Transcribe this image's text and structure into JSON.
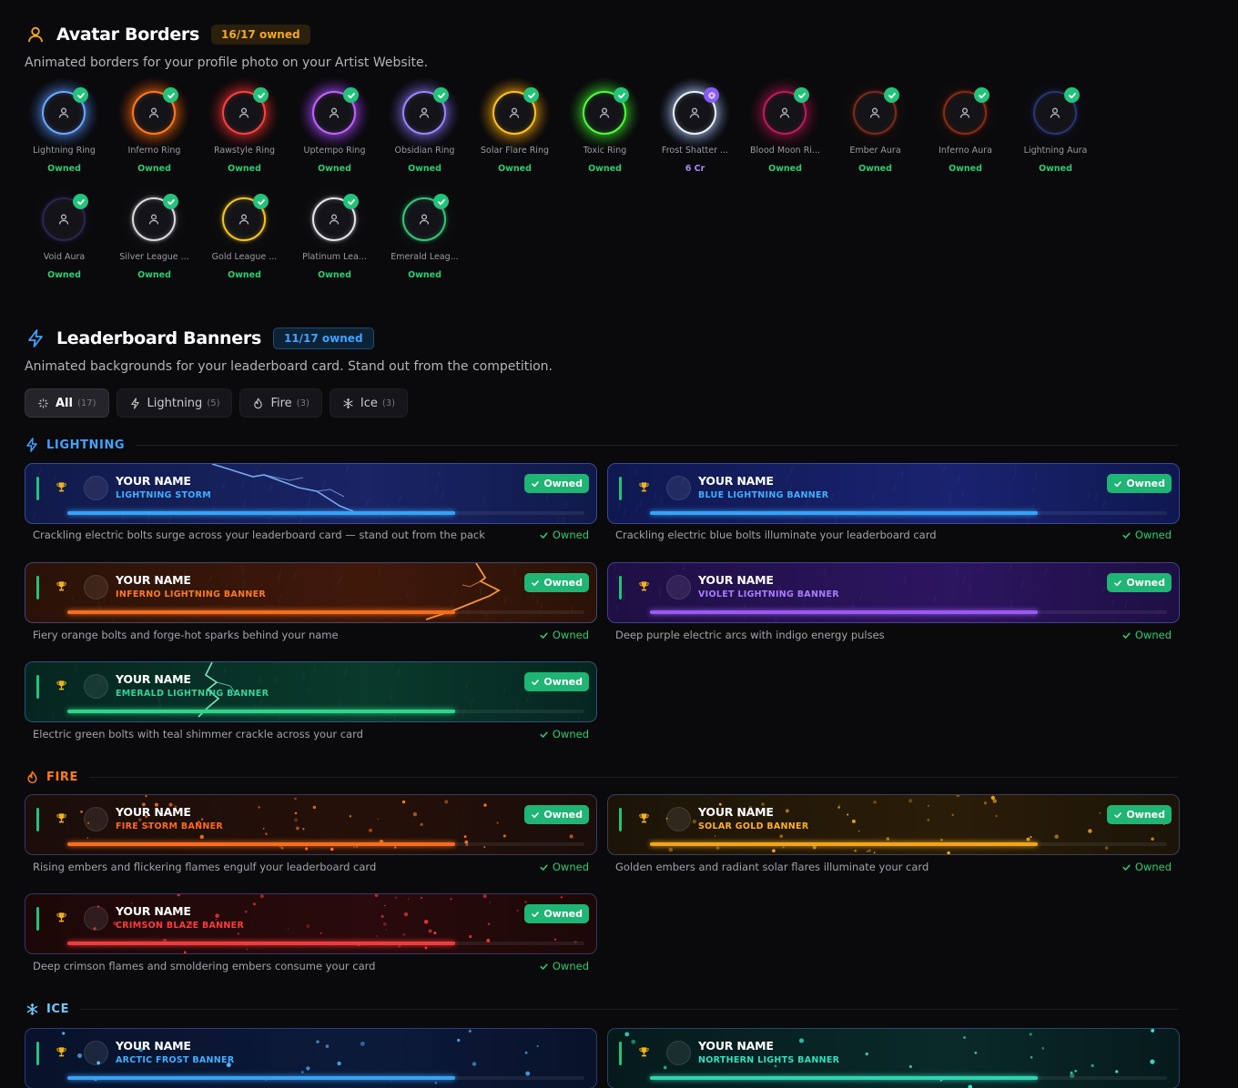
{
  "avatar_borders": {
    "title": "Avatar Borders",
    "badge": "16/17 owned",
    "subtitle": "Animated borders for your profile photo on your Artist Website.",
    "items": [
      {
        "name": "Lightning Ring",
        "status": "Owned",
        "color": "#6aa8ff",
        "glow": "#3b6fd6",
        "badge": "check"
      },
      {
        "name": "Inferno Ring",
        "status": "Owned",
        "color": "#ff7a1a",
        "glow": "#ff5a00",
        "badge": "check"
      },
      {
        "name": "Rawstyle Ring",
        "status": "Owned",
        "color": "#ff4040",
        "glow": "#d81f1f",
        "badge": "check"
      },
      {
        "name": "Uptempo Ring",
        "status": "Owned",
        "color": "#c066ff",
        "glow": "#9b30ff",
        "badge": "check"
      },
      {
        "name": "Obsidian Ring",
        "status": "Owned",
        "color": "#9a86ff",
        "glow": "#6d5ad6",
        "badge": "check"
      },
      {
        "name": "Solar Flare Ring",
        "status": "Owned",
        "color": "#ffc21a",
        "glow": "#ff9a00",
        "badge": "check"
      },
      {
        "name": "Toxic Ring",
        "status": "Owned",
        "color": "#4dff3a",
        "glow": "#2ecc1f",
        "badge": "check"
      },
      {
        "name": "Frost Shatter ...",
        "status": "6 Cr",
        "color": "#e6f0ff",
        "glow": "#7fa6ff",
        "badge": "cost"
      },
      {
        "name": "Blood Moon Ri...",
        "status": "Owned",
        "color": "#c01a5a",
        "glow": "#8a1040",
        "badge": "check"
      },
      {
        "name": "Ember Aura",
        "status": "Owned",
        "color": "#7a2a1a",
        "glow": "#4a1a10",
        "badge": "check"
      },
      {
        "name": "Inferno Aura",
        "status": "Owned",
        "color": "#8a2a14",
        "glow": "#4d1a0c",
        "badge": "check"
      },
      {
        "name": "Lightning Aura",
        "status": "Owned",
        "color": "#2a3470",
        "glow": "#1b2350",
        "badge": "check"
      },
      {
        "name": "Void Aura",
        "status": "Owned",
        "color": "#2c2550",
        "glow": "#1c1838",
        "badge": "check"
      },
      {
        "name": "Silver League ...",
        "status": "Owned",
        "color": "#d8d8de",
        "glow": "#3a3a40",
        "badge": "check"
      },
      {
        "name": "Gold League ...",
        "status": "Owned",
        "color": "#f5c51a",
        "glow": "#3a3010",
        "badge": "check"
      },
      {
        "name": "Platinum Lea...",
        "status": "Owned",
        "color": "#e4e4ea",
        "glow": "#38383e",
        "badge": "check"
      },
      {
        "name": "Emerald Leag...",
        "status": "Owned",
        "color": "#34c37a",
        "glow": "#12301e",
        "badge": "check"
      }
    ]
  },
  "leaderboard": {
    "title": "Leaderboard Banners",
    "badge": "11/17 owned",
    "subtitle": "Animated backgrounds for your leaderboard card. Stand out from the competition.",
    "tabs": [
      {
        "label": "All",
        "count": "(17)",
        "icon": "sparkle-icon"
      },
      {
        "label": "Lightning",
        "count": "(5)",
        "icon": "bolt-icon"
      },
      {
        "label": "Fire",
        "count": "(3)",
        "icon": "flame-icon"
      },
      {
        "label": "Ice",
        "count": "(3)",
        "icon": "snowflake-icon"
      }
    ],
    "categories": {
      "lightning": {
        "label": "LIGHTNING",
        "color": "#3fa3ff"
      },
      "fire": {
        "label": "FIRE",
        "color": "#ff7a1a"
      },
      "ice": {
        "label": "ICE",
        "color": "#6ec8ff"
      }
    },
    "placeholder_name": "YOUR NAME",
    "owned_label": "Owned",
    "banners": [
      {
        "name": "LIGHTNING STORM",
        "desc": "Crackling electric bolts surge across your leaderboard card — stand out from the pack",
        "status": "Owned",
        "name_color": "#3fb0ff",
        "bar": "#36a2f5",
        "progress": 0.75,
        "bg1": "#101a4a",
        "bg2": "#1a2466",
        "fx": "bolt",
        "fx_color": "#7fb8ff"
      },
      {
        "name": "BLUE LIGHTNING BANNER",
        "desc": "Crackling electric blue bolts illuminate your leaderboard card",
        "status": "Owned",
        "name_color": "#3fb0ff",
        "bar": "#36a2f5",
        "progress": 0.75,
        "bg1": "#0f1850",
        "bg2": "#1a2370",
        "fx": "none",
        "fx_color": "#7fb8ff"
      },
      {
        "name": "INFERNO LIGHTNING BANNER",
        "desc": "Fiery orange bolts and forge-hot sparks behind your name",
        "status": "Owned",
        "name_color": "#ff7a1a",
        "bar": "#f56d1d",
        "progress": 0.75,
        "bg1": "#2a1208",
        "bg2": "#40180a",
        "fx": "bolt2",
        "fx_color": "#ff9a3a"
      },
      {
        "name": "VIOLET LIGHTNING BANNER",
        "desc": "Deep purple electric arcs with indigo energy pulses",
        "status": "Owned",
        "name_color": "#a97bff",
        "bar": "#9a5af0",
        "progress": 0.75,
        "bg1": "#1e0f44",
        "bg2": "#2d1560",
        "fx": "none",
        "fx_color": "#b07aff"
      },
      {
        "name": "EMERALD LIGHTNING BANNER",
        "desc": "Electric green bolts with teal shimmer crackle across your card",
        "status": "Owned",
        "name_color": "#34d399",
        "bar": "#2ed48a",
        "progress": 0.75,
        "bg1": "#052620",
        "bg2": "#0a3a2c",
        "fx": "bolt3",
        "fx_color": "#7ff0c8"
      },
      {
        "name": "FIRE STORM BANNER",
        "desc": "Rising embers and flickering flames engulf your leaderboard card",
        "status": "Owned",
        "name_color": "#ff6a1a",
        "bar": "#f56d1d",
        "progress": 0.75,
        "bg1": "#1a0d0a",
        "bg2": "#251009",
        "fx": "embers",
        "fx_color": "#ff7a1a"
      },
      {
        "name": "SOLAR GOLD BANNER",
        "desc": "Golden embers and radiant solar flares illuminate your card",
        "status": "Owned",
        "name_color": "#ffb020",
        "bar": "#f2a51a",
        "progress": 0.75,
        "bg1": "#1c1408",
        "bg2": "#2a1d08",
        "fx": "embers",
        "fx_color": "#ffb020"
      },
      {
        "name": "CRIMSON BLAZE BANNER",
        "desc": "Deep crimson flames and smoldering embers consume your card",
        "status": "Owned",
        "name_color": "#ff3a3a",
        "bar": "#ef3b3b",
        "progress": 0.75,
        "bg1": "#1c0808",
        "bg2": "#2a0a0c",
        "fx": "embers",
        "fx_color": "#ff3a3a"
      },
      {
        "name": "ARCTIC FROST BANNER",
        "desc": "",
        "status": "",
        "name_color": "#3fb0ff",
        "bar": "#36a2f5",
        "progress": 0.75,
        "bg1": "#08122a",
        "bg2": "#0c1a3a",
        "fx": "flakes",
        "fx_color": "#4fb8ff"
      },
      {
        "name": "NORTHERN LIGHTS BANNER",
        "desc": "",
        "status": "",
        "name_color": "#2ee0c0",
        "bar": "#2ed4b0",
        "progress": 0.75,
        "bg1": "#061a1c",
        "bg2": "#0a2a2a",
        "fx": "flakes",
        "fx_color": "#3ef0d0"
      }
    ]
  }
}
